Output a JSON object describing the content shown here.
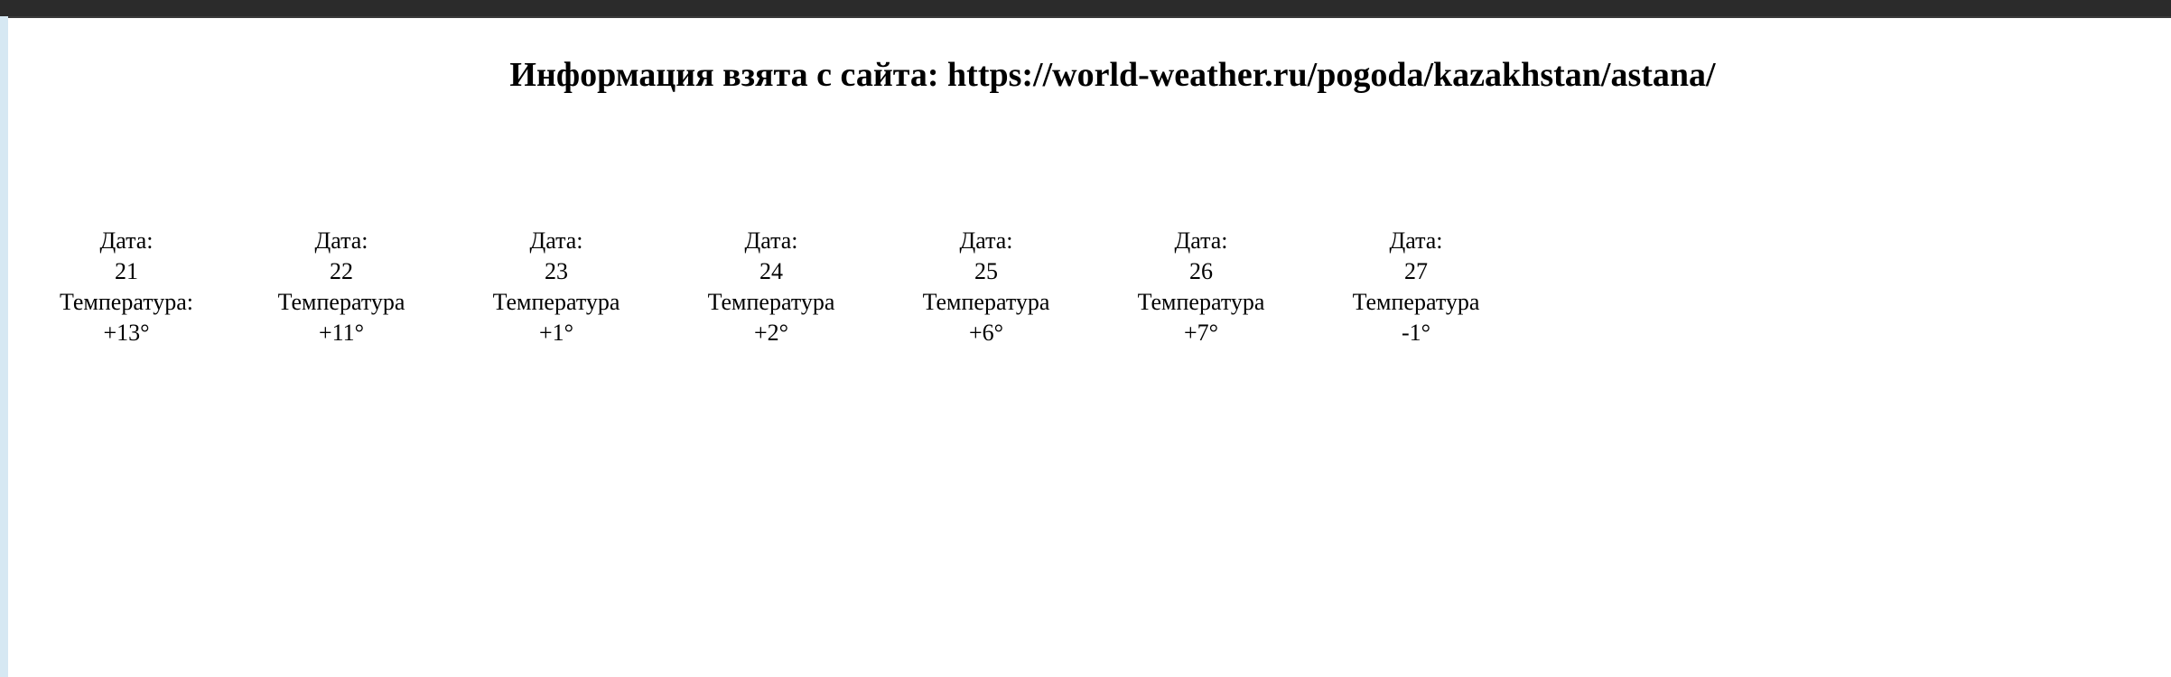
{
  "title": "Информация взята с сайта: https://world-weather.ru/pogoda/kazakhstan/astana/",
  "days": [
    {
      "date_label": "Дата:",
      "date": "21",
      "temp_label": "Температура:",
      "temp": "+13°"
    },
    {
      "date_label": "Дата:",
      "date": "22",
      "temp_label": "Температура",
      "temp": "+11°"
    },
    {
      "date_label": "Дата:",
      "date": "23",
      "temp_label": "Температура",
      "temp": "+1°"
    },
    {
      "date_label": "Дата:",
      "date": "24",
      "temp_label": "Температура",
      "temp": "+2°"
    },
    {
      "date_label": "Дата:",
      "date": "25",
      "temp_label": "Температура",
      "temp": "+6°"
    },
    {
      "date_label": "Дата:",
      "date": "26",
      "temp_label": "Температура",
      "temp": "+7°"
    },
    {
      "date_label": "Дата:",
      "date": "27",
      "temp_label": "Температура",
      "temp": "-1°"
    }
  ]
}
